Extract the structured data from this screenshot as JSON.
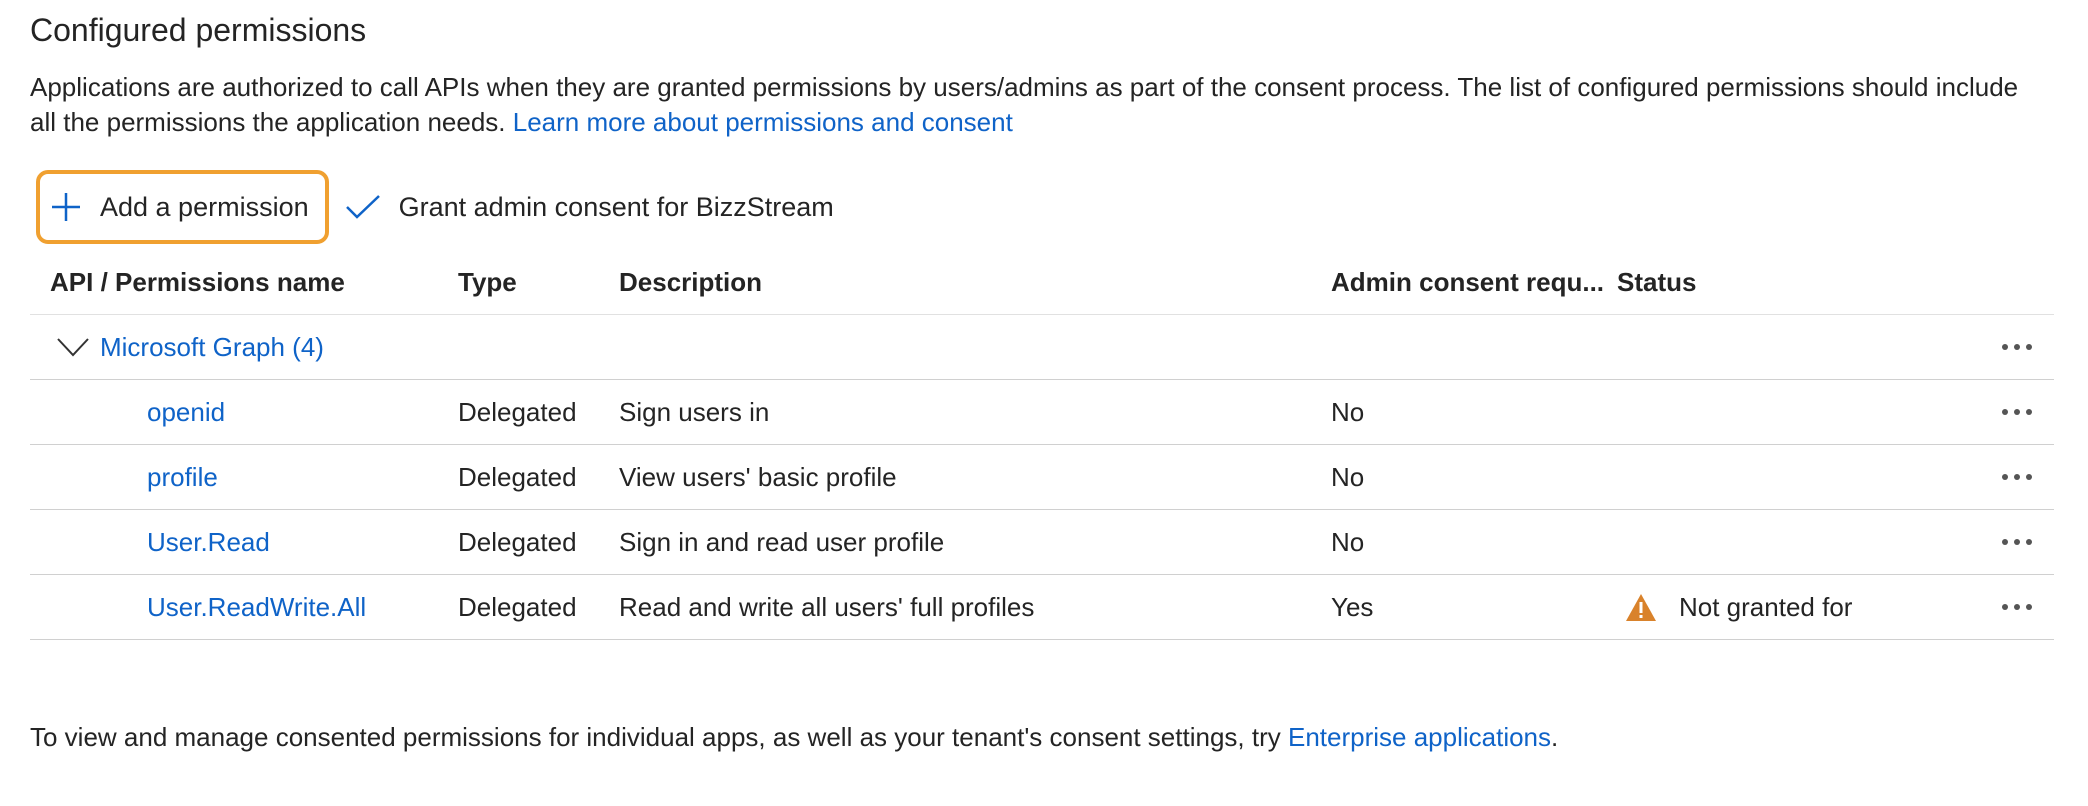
{
  "section": {
    "title": "Configured permissions",
    "intro_text": "Applications are authorized to call APIs when they are granted permissions by users/admins as part of the consent process. The list of configured permissions should include all the permissions the application needs.",
    "intro_link": "Learn more about permissions and consent"
  },
  "toolbar": {
    "add_label": "Add a permission",
    "grant_label": "Grant admin consent for BizzStream"
  },
  "table": {
    "headers": {
      "name": "API / Permissions name",
      "type": "Type",
      "description": "Description",
      "admin": "Admin consent requ...",
      "status": "Status"
    },
    "group": {
      "label": "Microsoft Graph (4)"
    },
    "rows": [
      {
        "name": "openid",
        "type": "Delegated",
        "description": "Sign users in",
        "admin": "No",
        "status": ""
      },
      {
        "name": "profile",
        "type": "Delegated",
        "description": "View users' basic profile",
        "admin": "No",
        "status": ""
      },
      {
        "name": "User.Read",
        "type": "Delegated",
        "description": "Sign in and read user profile",
        "admin": "No",
        "status": ""
      },
      {
        "name": "User.ReadWrite.All",
        "type": "Delegated",
        "description": "Read and write all users' full profiles",
        "admin": "Yes",
        "status": "Not granted for"
      }
    ]
  },
  "footer": {
    "text": "To view and manage consented permissions for individual apps, as well as your tenant's consent settings, try",
    "link": "Enterprise applications",
    "suffix": "."
  },
  "colors": {
    "link": "#0f63c8",
    "highlight": "#f0a030",
    "warning": "#d9822b"
  }
}
